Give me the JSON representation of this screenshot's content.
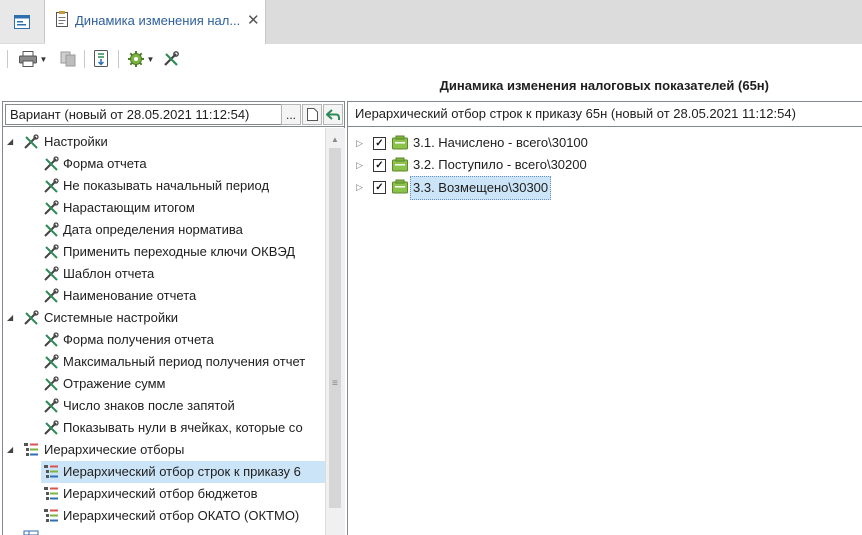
{
  "tabs": {
    "home_icon": "window-icon",
    "doc_tab_label": "Динамика изменения нал...",
    "close_glyph": "✕"
  },
  "toolbar": {
    "print_icon": "printer-icon",
    "copy_icon": "copy-icon",
    "export_icon": "export-icon",
    "settings_icon": "gear-icon",
    "tools_icon": "wrench-screwdriver-icon"
  },
  "report": {
    "title": "Динамика изменения налоговых показателей (65н)"
  },
  "variant": {
    "value": "Вариант (новый от 28.05.2021 11:12:54)",
    "more_label": "...",
    "save_icon": "page-icon",
    "back_icon": "back-arrow-icon"
  },
  "left_tree": {
    "settings": {
      "label": "Настройки",
      "items": [
        "Форма отчета",
        "Не показывать начальный период",
        "Нарастающим итогом",
        "Дата определения норматива",
        "Применить переходные ключи ОКВЭД",
        "Шаблон отчета",
        "Наименование отчета"
      ]
    },
    "system_settings": {
      "label": "Системные настройки",
      "items": [
        "Форма получения отчета",
        "Максимальный период получения отчет",
        "Отражение сумм",
        "Число знаков после запятой",
        "Показывать нули в ячейках, которые со"
      ]
    },
    "hierarchical": {
      "label": "Иерархические отборы",
      "items": [
        "Иерархичеcкий отбор строк к приказу 6",
        "Иерархический отбор бюджетов",
        "Иерархический отбор ОКАТО (ОКТМО)"
      ],
      "selected_index": 0
    }
  },
  "right_panel": {
    "header": "Иерархический отбор строк к приказу 65н (новый от 28.05.2021 11:12:54)",
    "rows": [
      {
        "label": "3.1. Начислено - всего\\30100",
        "checked": true
      },
      {
        "label": "3.2. Поступило - всего\\30200",
        "checked": true
      },
      {
        "label": "3.3. Возмещено\\30300",
        "checked": true
      }
    ]
  },
  "colors": {
    "accent": "#2e5f9e",
    "selection": "#cce4f7",
    "folder_green": "#7cb342"
  }
}
